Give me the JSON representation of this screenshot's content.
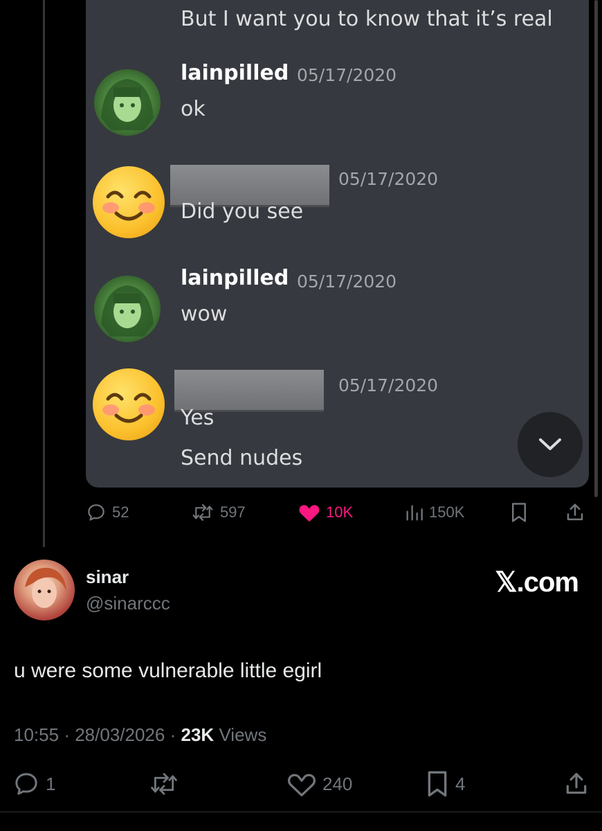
{
  "embedded_chat": {
    "messages": [
      {
        "author": "",
        "timestamp": "",
        "text": "But I want you to know that it’s real"
      },
      {
        "author": "lainpilled",
        "timestamp": "05/17/2020",
        "text": "ok"
      },
      {
        "author": "",
        "timestamp": "05/17/2020",
        "text": "Did you see"
      },
      {
        "author": "lainpilled",
        "timestamp": "05/17/2020",
        "text": "wow"
      },
      {
        "author": "",
        "timestamp": "05/17/2020",
        "text": "Yes",
        "text2": "Send nudes"
      }
    ]
  },
  "quoted_actions": {
    "replies": "52",
    "reposts": "597",
    "likes": "10K",
    "views": "150K"
  },
  "tweet": {
    "display_name": "sinar",
    "handle": "@sinarccc",
    "brand": "𝕏.com",
    "body": "u were some vulnerable little egirl",
    "time": "10:55",
    "sep1": "·",
    "date": "28/03/2026",
    "sep2": "·",
    "views_count": "23K",
    "views_label": "Views",
    "replies": "1",
    "likes": "240",
    "bookmarks": "4"
  },
  "colors": {
    "like_active": "#f91880",
    "muted": "#71767b",
    "discord_bg": "#36393f"
  }
}
